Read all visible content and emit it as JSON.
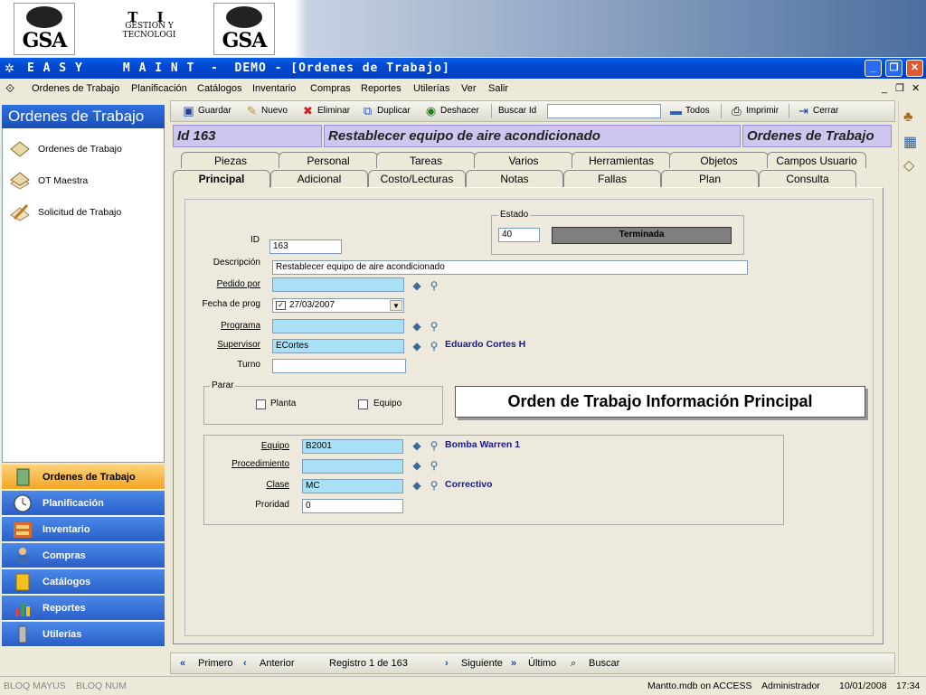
{
  "banner": {
    "logo_left": "GSA",
    "logo_right": "GSA",
    "ti_title": "T I",
    "ti_line1": "GESTION Y",
    "ti_line2": "TECNOLOGI"
  },
  "window": {
    "title": "E A S Y     M A I N T  -  DEMO - [Ordenes de Trabajo]"
  },
  "menu": {
    "items": [
      "Ordenes de Trabajo",
      "Planificación",
      "Catálogos",
      "Inventario",
      "Compras",
      "Reportes",
      "Utilerías",
      "Ver",
      "Salir"
    ]
  },
  "left_panel": {
    "title": "Ordenes de Trabajo",
    "items": [
      "Ordenes de Trabajo",
      "OT Maestra",
      "Solicitud de Trabajo"
    ]
  },
  "nav": {
    "items": [
      "Ordenes de Trabajo",
      "Planificación",
      "Inventario",
      "Compras",
      "Catálogos",
      "Reportes",
      "Utilerías"
    ]
  },
  "toolbar": {
    "guardar": "Guardar",
    "nuevo": "Nuevo",
    "eliminar": "Eliminar",
    "duplicar": "Duplicar",
    "deshacer": "Deshacer",
    "buscar_id": "Buscar Id",
    "todos": "Todos",
    "imprimir": "Imprimir",
    "cerrar": "Cerrar"
  },
  "info": {
    "id": "Id  163",
    "desc": "Restablecer equipo de aire acondicionado",
    "module": "Ordenes de Trabajo"
  },
  "tabs_back": [
    "Piezas",
    "Personal",
    "Tareas",
    "Varios",
    "Herramientas",
    "Objetos",
    "Campos Usuario"
  ],
  "tabs_front": [
    "Principal",
    "Adicional",
    "Costo/Lecturas",
    "Notas",
    "Fallas",
    "Plan",
    "Consulta"
  ],
  "form": {
    "id_label": "ID",
    "id_value": "163",
    "estado_legend": "Estado",
    "estado_code": "40",
    "estado_text": "Terminada",
    "descripcion_label": "Descripción",
    "descripcion_value": "Restablecer equipo de aire acondicionado",
    "pedido_label": "Pedido por",
    "pedido_value": "",
    "fecha_label": "Fecha de prog",
    "fecha_value": "27/03/2007",
    "programa_label": "Programa",
    "programa_value": "",
    "supervisor_label": "Supervisor",
    "supervisor_value": "ECortes",
    "supervisor_name": "Eduardo Cortes H",
    "turno_label": "Turno",
    "turno_value": "",
    "parar_legend": "Parar",
    "planta_label": "Planta",
    "equipo_chk_label": "Equipo",
    "banner_text": "Orden de Trabajo Información Principal",
    "equipo_label": "Equipo",
    "equipo_value": "B2001",
    "equipo_name": "Bomba Warren 1",
    "procedimiento_label": "Procedimiento",
    "procedimiento_value": "",
    "clase_label": "Clase",
    "clase_value": "MC",
    "clase_name": "Correctivo",
    "prioridad_label": "Proridad",
    "prioridad_value": "0"
  },
  "bottom": {
    "primero": "Primero",
    "anterior": "Anterior",
    "registro": "Registro 1 de 163",
    "siguiente": "Siguiente",
    "ultimo": "Último",
    "buscar": "Buscar"
  },
  "status": {
    "mayus": "BLOQ MAYUS",
    "num": "BLOQ NUM",
    "db": "Mantto.mdb on ACCESS",
    "user": "Administrador",
    "date": "10/01/2008",
    "time": "17:34"
  }
}
